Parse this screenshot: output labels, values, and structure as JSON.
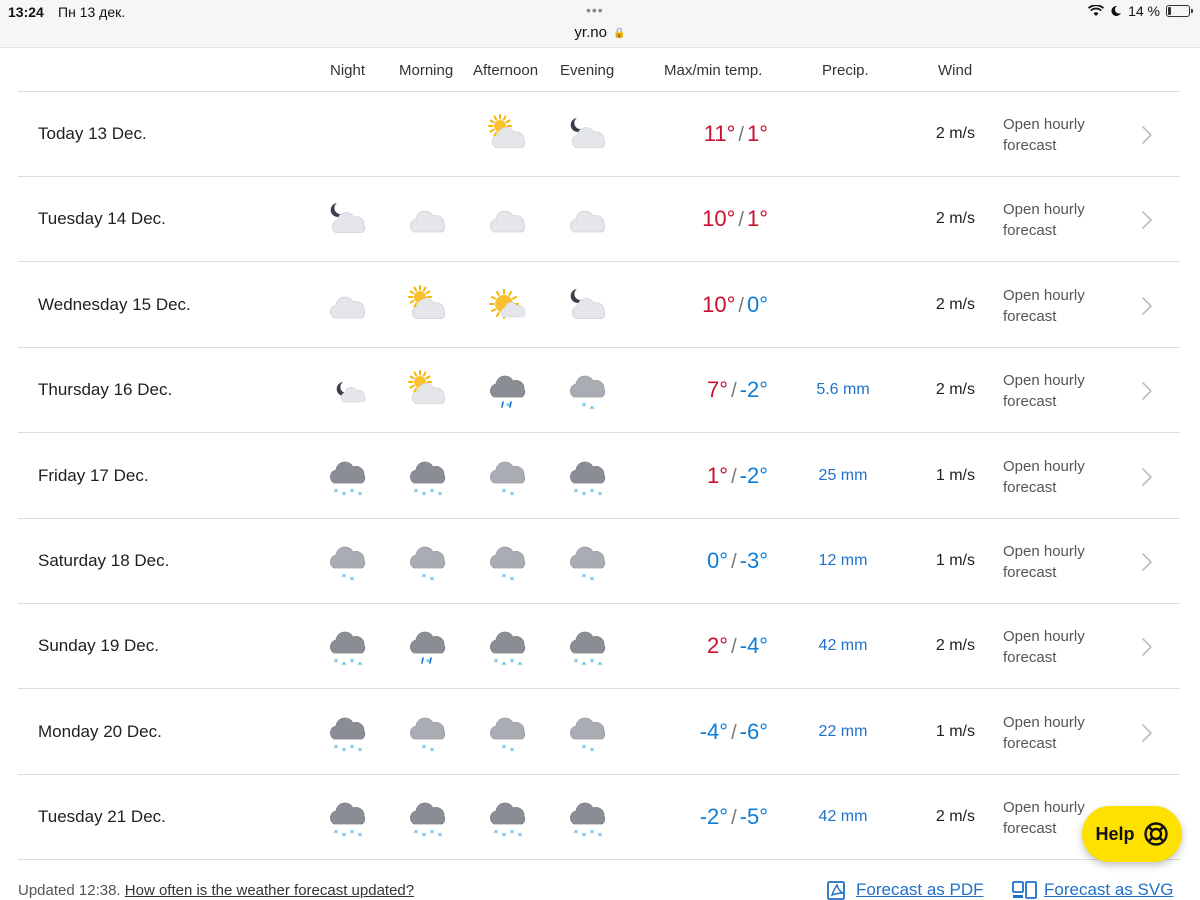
{
  "status_bar": {
    "time": "13:24",
    "date": "Пн 13 дек.",
    "url": "yr.no",
    "battery": "14 %",
    "battery_level": 0.14
  },
  "columns": {
    "night": "Night",
    "morning": "Morning",
    "afternoon": "Afternoon",
    "evening": "Evening",
    "temp": "Max/min temp.",
    "precip": "Precip.",
    "wind": "Wind"
  },
  "rows": [
    {
      "day": "Today 13 Dec.",
      "icons": [
        "",
        "",
        "partly-cloudy-day-icon",
        "partly-cloudy-night-icon"
      ],
      "max": "11°",
      "min": "1°",
      "precip": "",
      "wind": "2 m/s",
      "link": "Open hourly forecast"
    },
    {
      "day": "Tuesday 14 Dec.",
      "icons": [
        "partly-cloudy-night-icon",
        "cloudy-icon",
        "cloudy-icon",
        "cloudy-icon"
      ],
      "max": "10°",
      "min": "1°",
      "precip": "",
      "wind": "2 m/s",
      "link": "Open hourly forecast"
    },
    {
      "day": "Wednesday 15 Dec.",
      "icons": [
        "cloudy-icon",
        "partly-cloudy-day-icon",
        "fair-day-icon",
        "partly-cloudy-night-icon"
      ],
      "max": "10°",
      "min": "0°",
      "precip": "",
      "wind": "2 m/s",
      "link": "Open hourly forecast"
    },
    {
      "day": "Thursday 16 Dec.",
      "icons": [
        "fair-night-icon",
        "partly-cloudy-day-icon",
        "sleet-icon",
        "light-snow-icon"
      ],
      "max": "7°",
      "min": "-2°",
      "precip": "5.6 mm",
      "wind": "2 m/s",
      "link": "Open hourly forecast"
    },
    {
      "day": "Friday 17 Dec.",
      "icons": [
        "snow-icon",
        "snow-icon",
        "light-snow-icon",
        "snow-icon"
      ],
      "max": "1°",
      "min": "-2°",
      "precip": "25 mm",
      "wind": "1 m/s",
      "link": "Open hourly forecast"
    },
    {
      "day": "Saturday 18 Dec.",
      "icons": [
        "light-snow-icon",
        "light-snow-icon",
        "light-snow-icon",
        "light-snow-icon"
      ],
      "max": "0°",
      "min": "-3°",
      "precip": "12 mm",
      "wind": "1 m/s",
      "link": "Open hourly forecast"
    },
    {
      "day": "Sunday 19 Dec.",
      "icons": [
        "snow-icon",
        "sleet-icon",
        "snow-icon",
        "snow-icon"
      ],
      "max": "2°",
      "min": "-4°",
      "precip": "42 mm",
      "wind": "2 m/s",
      "link": "Open hourly forecast"
    },
    {
      "day": "Monday 20 Dec.",
      "icons": [
        "snow-icon",
        "light-snow-icon",
        "light-snow-icon",
        "light-snow-icon"
      ],
      "max": "-4°",
      "min": "-6°",
      "precip": "22 mm",
      "wind": "1 m/s",
      "link": "Open hourly forecast"
    },
    {
      "day": "Tuesday 21 Dec.",
      "icons": [
        "snow-icon",
        "snow-icon",
        "snow-icon",
        "snow-icon"
      ],
      "max": "-2°",
      "min": "-5°",
      "precip": "42 mm",
      "wind": "2 m/s",
      "link": "Open hourly forecast"
    }
  ],
  "footer": {
    "updated": "Updated 12:38.",
    "updated_link": "How often is the weather forecast updated?",
    "pdf": "Forecast as PDF",
    "svg": "Forecast as SVG"
  },
  "help": "Help",
  "colors": {
    "warm": "#c8102e",
    "cold": "#0d7ed8",
    "precip": "#1f72c9",
    "help_bg": "#ffe100"
  }
}
